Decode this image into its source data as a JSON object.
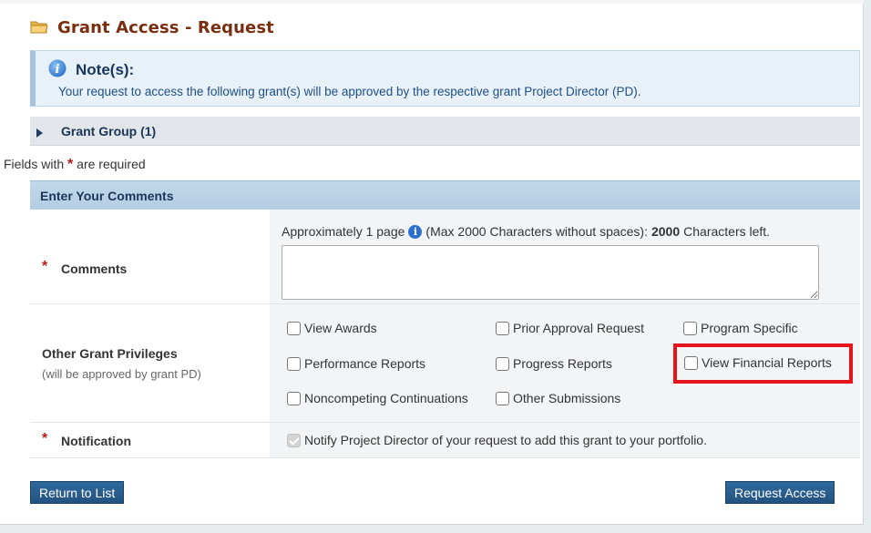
{
  "header": {
    "title": "Grant Access - Request",
    "icon": "folder-icon"
  },
  "note": {
    "title": "Note(s):",
    "icon": "info-icon",
    "text": "Your request to access the following grant(s) will be approved by the respective grant Project Director (PD)."
  },
  "grant_group": {
    "label": "Grant Group (1)"
  },
  "required_note": {
    "prefix": "Fields with",
    "star": "*",
    "suffix": "are required"
  },
  "section": {
    "title": "Enter Your Comments"
  },
  "comments": {
    "label": "Comments",
    "star": "*",
    "hint_prefix": "Approximately 1 page",
    "hint_middle": "(Max 2000 Characters without spaces):",
    "chars_left": "2000",
    "hint_suffix": "Characters left.",
    "value": ""
  },
  "privileges": {
    "label": "Other Grant Privileges",
    "sublabel": "(will be approved by grant PD)",
    "options": [
      {
        "label": "View Awards",
        "checked": false
      },
      {
        "label": "Prior Approval Request",
        "checked": false
      },
      {
        "label": "Program Specific",
        "checked": false
      },
      {
        "label": "Performance Reports",
        "checked": false
      },
      {
        "label": "Progress Reports",
        "checked": false
      },
      {
        "label": "View Financial Reports",
        "checked": false
      },
      {
        "label": "Noncompeting Continuations",
        "checked": false
      },
      {
        "label": "Other Submissions",
        "checked": false
      }
    ]
  },
  "notification": {
    "label": "Notification",
    "star": "*",
    "text": "Notify Project Director of your request to add this grant to your portfolio.",
    "checked": true,
    "disabled": true
  },
  "buttons": {
    "return": "Return to List",
    "request": "Request Access"
  },
  "colors": {
    "title": "#7a2e10",
    "button": "#22527f",
    "highlight": "#e4131c",
    "star": "#b21a1a"
  }
}
